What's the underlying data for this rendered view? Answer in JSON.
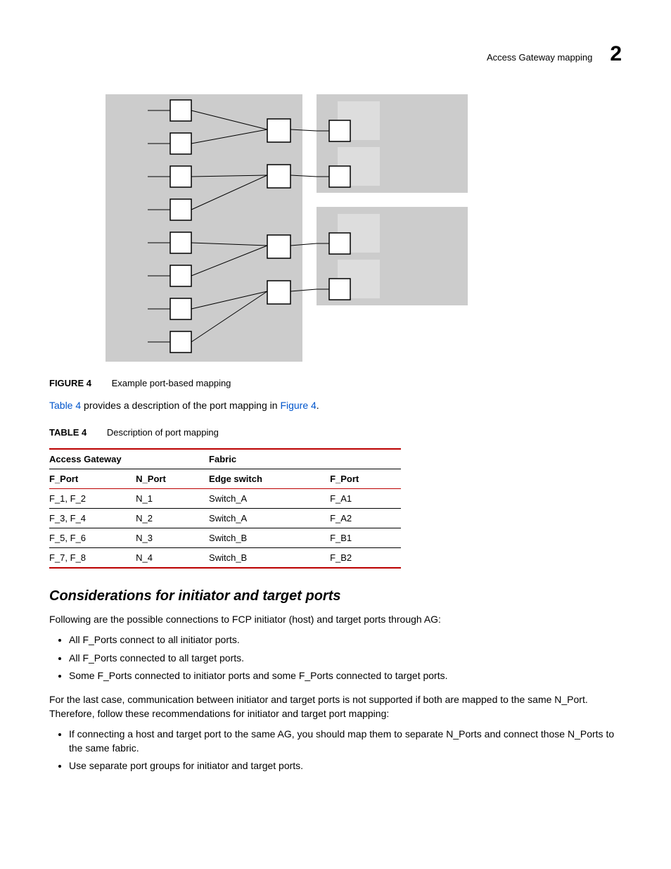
{
  "header": {
    "title": "Access Gateway mapping",
    "chapter_num": "2"
  },
  "figure": {
    "label": "FIGURE 4",
    "title": "Example port-based mapping"
  },
  "intro_para": {
    "pre": "",
    "link1": "Table 4",
    "mid": " provides a description of the port mapping in ",
    "link2": "Figure 4",
    "post": "."
  },
  "table": {
    "label": "TABLE 4",
    "title": "Description of port mapping",
    "group_headers": [
      "Access Gateway",
      "Fabric"
    ],
    "columns": [
      "F_Port",
      "N_Port",
      "Edge switch",
      "F_Port"
    ],
    "rows": [
      [
        "F_1, F_2",
        "N_1",
        "Switch_A",
        "F_A1"
      ],
      [
        "F_3, F_4",
        "N_2",
        "Switch_A",
        "F_A2"
      ],
      [
        "F_5, F_6",
        "N_3",
        "Switch_B",
        "F_B1"
      ],
      [
        "F_7, F_8",
        "N_4",
        "Switch_B",
        "F_B2"
      ]
    ]
  },
  "subheading": "Considerations for initiator and target ports",
  "intro2": "Following are the possible connections to FCP initiator (host) and target ports through AG:",
  "list1": [
    "All F_Ports connect to all initiator ports.",
    "All F_Ports connected to all target ports.",
    "Some F_Ports connected to initiator ports and some F_Ports connected to target ports."
  ],
  "para2": "For the last case, communication between initiator and target ports is not supported if both are mapped to the same N_Port. Therefore, follow these recommendations for initiator and target port mapping:",
  "list2": [
    "If connecting a host and target port to the same AG, you should map them to separate N_Ports and connect those N_Ports to the same fabric.",
    "Use separate port groups for initiator and target ports."
  ]
}
